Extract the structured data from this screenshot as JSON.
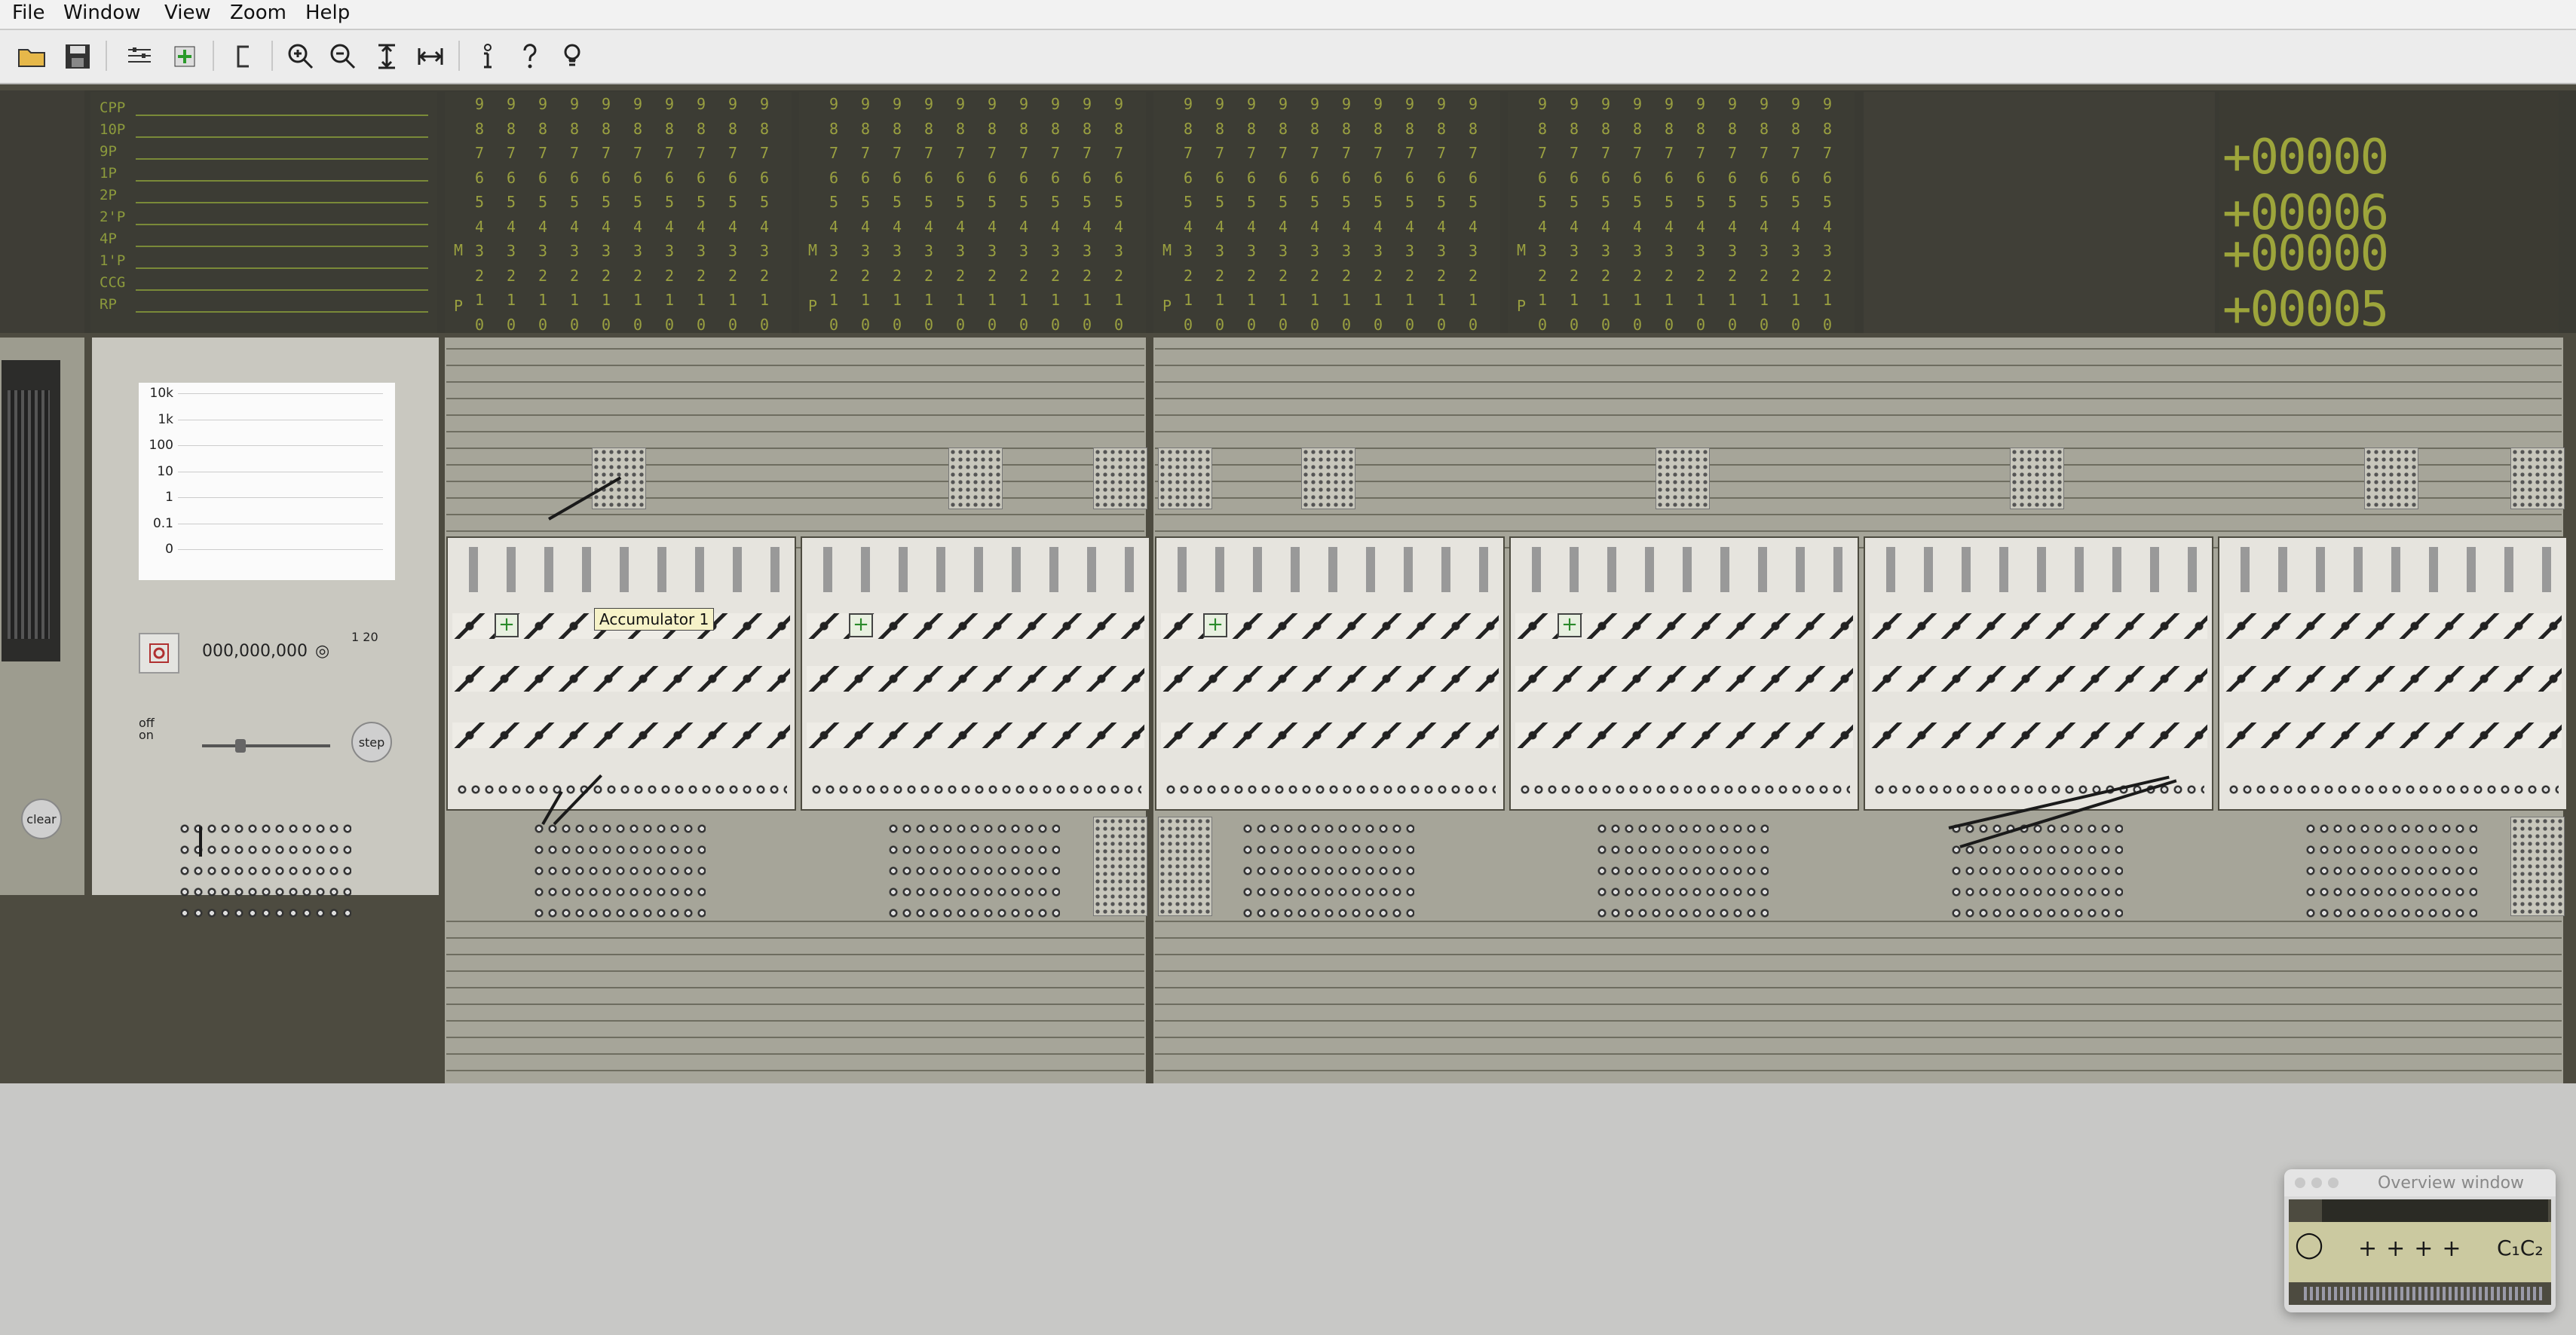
{
  "menu": {
    "file": "File",
    "window": "Window",
    "view": "View",
    "zoom": "Zoom",
    "help": "Help"
  },
  "toolbar": {
    "buttons": [
      "open-icon",
      "save-icon",
      "config-icon",
      "add-icon",
      "bracket-icon",
      "zoom-in-icon",
      "zoom-out-icon",
      "fit-height-icon",
      "fit-width-icon",
      "info-icon",
      "help-icon",
      "lightbulb-icon"
    ]
  },
  "trace": {
    "labels": [
      "CPP",
      "10P",
      "9P",
      "1P",
      "2P",
      "2'P",
      "4P",
      "1'P",
      "CCG",
      "RP"
    ]
  },
  "register": {
    "digits": [
      "9",
      "8",
      "7",
      "6",
      "5",
      "4",
      "3",
      "2",
      "1",
      "0"
    ],
    "m_label": "M",
    "p_label": "P"
  },
  "display": {
    "line1": "+00000 +00006",
    "line2": "+00000 +00005"
  },
  "log_chart": {
    "ticks": [
      "10k",
      "1k",
      "100",
      "10",
      "1",
      "0.1",
      "0"
    ]
  },
  "controls": {
    "counter": "000,000,000",
    "clear": "clear",
    "step": "step",
    "off_on": "off\non",
    "rate": "1 20"
  },
  "accumulator": {
    "tooltip": "Accumulator 1",
    "zero_one": "0",
    "one": "1"
  },
  "overview": {
    "title": "Overview window"
  },
  "colors": {
    "display_green": "#9da53b",
    "panel_dark": "#4d4b40"
  }
}
